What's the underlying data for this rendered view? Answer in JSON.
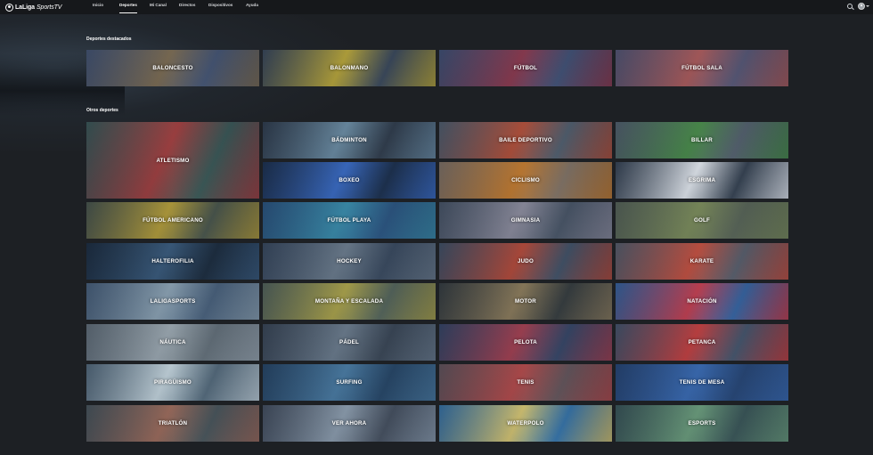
{
  "header": {
    "logo_main": "LaLiga",
    "logo_tv": "SportsTV",
    "nav": [
      {
        "label": "Inicio",
        "active": false
      },
      {
        "label": "Deportes",
        "active": true
      },
      {
        "label": "Mi Canal",
        "active": false
      },
      {
        "label": "Directos",
        "active": false
      },
      {
        "label": "Dispositivos",
        "active": false
      },
      {
        "label": "Ayuda",
        "active": false
      }
    ],
    "icons": [
      "search-icon",
      "avatar"
    ]
  },
  "featured": {
    "title": "Deportes destacados",
    "items": [
      {
        "label": "BALONCESTO",
        "bg": "#4a5a78",
        "accent": "#7b6b52"
      },
      {
        "label": "BALONMANO",
        "bg": "#3e4c5e",
        "accent": "#b4a23a"
      },
      {
        "label": "FÚTBOL",
        "bg": "#46567a",
        "accent": "#8a3a4e"
      },
      {
        "label": "FÚTBOL SALA",
        "bg": "#5c5c7a",
        "accent": "#a85a5a"
      }
    ]
  },
  "others": {
    "title": "Otros deportes",
    "items": [
      {
        "label": "ATLETISMO",
        "bg": "#3f5e5a",
        "accent": "#a04040"
      },
      {
        "label": "BÁDMINTON",
        "bg": "#34404e",
        "accent": "#6a8aa0"
      },
      {
        "label": "BAILE DEPORTIVO",
        "bg": "#566472",
        "accent": "#b0503a"
      },
      {
        "label": "BILLAR",
        "bg": "#5a6672",
        "accent": "#4a8a4a"
      },
      {
        "label": "BOXEO",
        "bg": "#1f3350",
        "accent": "#3a6ac0"
      },
      {
        "label": "CICLISMO",
        "bg": "#8a7a6a",
        "accent": "#c07a30"
      },
      {
        "label": "ESGRIMA",
        "bg": "#3a4654",
        "accent": "#dde2e8"
      },
      {
        "label": "FÚTBOL AMERICANO",
        "bg": "#4e5a4e",
        "accent": "#b09a3a"
      },
      {
        "label": "FÚTBOL PLAYA",
        "bg": "#2f5a86",
        "accent": "#3a8aa8"
      },
      {
        "label": "GIMNASIA",
        "bg": "#4e5a6a",
        "accent": "#8a8a9a"
      },
      {
        "label": "GOLF",
        "bg": "#5e6a5a",
        "accent": "#7a8a5a"
      },
      {
        "label": "HALTEROFILIA",
        "bg": "#1f2f40",
        "accent": "#3a5a7a"
      },
      {
        "label": "HOCKEY",
        "bg": "#3e4e62",
        "accent": "#6a7a8a"
      },
      {
        "label": "JUDO",
        "bg": "#46566a",
        "accent": "#b04a3a"
      },
      {
        "label": "KARATE",
        "bg": "#5e6470",
        "accent": "#c05040"
      },
      {
        "label": "LALIGASPORTS",
        "bg": "#4e6680",
        "accent": "#8aa0b0"
      },
      {
        "label": "MONTAÑA Y ESCALADA",
        "bg": "#5a6a5e",
        "accent": "#a8a04a"
      },
      {
        "label": "MOTOR",
        "bg": "#3a4040",
        "accent": "#8a7a5a"
      },
      {
        "label": "NATACIÓN",
        "bg": "#3a6aa8",
        "accent": "#c04050"
      },
      {
        "label": "NÁUTICA",
        "bg": "#6a767e",
        "accent": "#9aa6ae"
      },
      {
        "label": "PÁDEL",
        "bg": "#3e4a58",
        "accent": "#6a7a8a"
      },
      {
        "label": "PELOTA",
        "bg": "#3a4a6a",
        "accent": "#a04050"
      },
      {
        "label": "PETANCA",
        "bg": "#4a5a70",
        "accent": "#c04040"
      },
      {
        "label": "PIRAGÜISMO",
        "bg": "#5a7080",
        "accent": "#c0d0d8"
      },
      {
        "label": "SURFING",
        "bg": "#2a4a6a",
        "accent": "#4a7aa0"
      },
      {
        "label": "TENIS",
        "bg": "#6a5a5e",
        "accent": "#b04a4a"
      },
      {
        "label": "TENIS DE MESA",
        "bg": "#2a4a7a",
        "accent": "#3a6ab0"
      },
      {
        "label": "TRIATLÓN",
        "bg": "#4e5a5e",
        "accent": "#9a6a5a"
      },
      {
        "label": "VER AHORA",
        "bg": "#4a5462",
        "accent": "#8a9aaa"
      },
      {
        "label": "WATERPOLO",
        "bg": "#3a7ab0",
        "accent": "#d0c070"
      },
      {
        "label": "ESPORTS",
        "bg": "#3e5a5a",
        "accent": "#6a9a7a"
      }
    ]
  }
}
